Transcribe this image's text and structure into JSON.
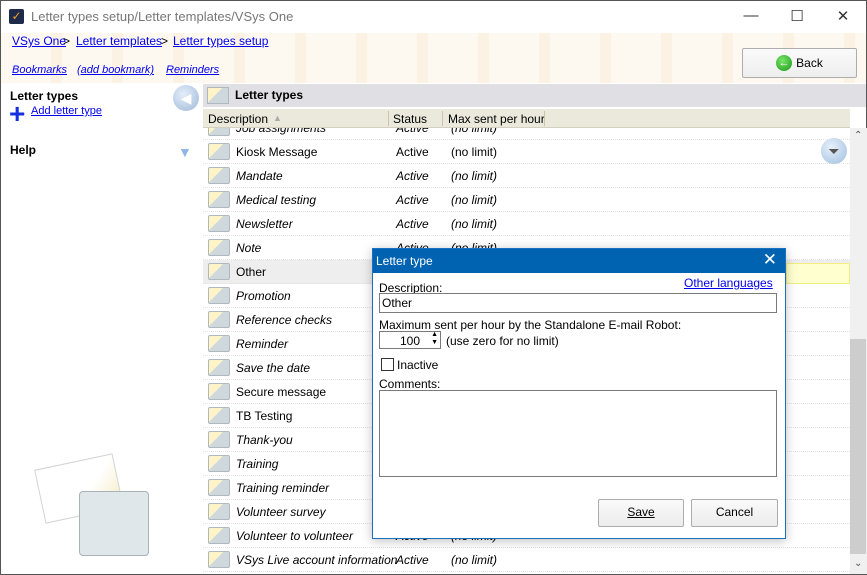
{
  "window": {
    "title": "Letter types setup/Letter templates/VSys One",
    "minimize": "—",
    "maximize": "☐",
    "close": "✕"
  },
  "breadcrumb": [
    {
      "label": "VSys One"
    },
    {
      "label": "Letter templates"
    },
    {
      "label": "Letter types setup"
    }
  ],
  "breadcrumb_sep": ">",
  "links": {
    "bookmarks": "Bookmarks",
    "add_bookmark": "(add bookmark)",
    "reminders": "Reminders"
  },
  "back_label": "Back",
  "sidebar": {
    "section1": "Letter types",
    "add_label": "Add letter type",
    "section2": "Help"
  },
  "grid": {
    "title": "Letter types",
    "columns": [
      "Description",
      "Status",
      "Max sent per hour"
    ],
    "sort_indicator": "▲",
    "rows": [
      {
        "d": "Job assignments",
        "s": "Active",
        "m": "(no limit)",
        "italic": true
      },
      {
        "d": "Kiosk Message",
        "s": "Active",
        "m": "(no limit)",
        "italic": false
      },
      {
        "d": "Mandate",
        "s": "Active",
        "m": "(no limit)",
        "italic": true
      },
      {
        "d": "Medical testing",
        "s": "Active",
        "m": "(no limit)",
        "italic": true
      },
      {
        "d": "Newsletter",
        "s": "Active",
        "m": "(no limit)",
        "italic": true
      },
      {
        "d": "Note",
        "s": "Active",
        "m": "(no limit)",
        "italic": true
      },
      {
        "d": "Other",
        "s": "",
        "m": "",
        "italic": false,
        "selected": true
      },
      {
        "d": "Promotion",
        "s": "",
        "m": "",
        "italic": true
      },
      {
        "d": "Reference checks",
        "s": "",
        "m": "",
        "italic": true
      },
      {
        "d": "Reminder",
        "s": "",
        "m": "",
        "italic": true
      },
      {
        "d": "Save the date",
        "s": "",
        "m": "",
        "italic": true
      },
      {
        "d": "Secure message",
        "s": "",
        "m": "",
        "italic": false
      },
      {
        "d": "TB Testing",
        "s": "",
        "m": "",
        "italic": false
      },
      {
        "d": "Thank-you",
        "s": "",
        "m": "",
        "italic": true
      },
      {
        "d": "Training",
        "s": "",
        "m": "",
        "italic": true
      },
      {
        "d": "Training reminder",
        "s": "",
        "m": "",
        "italic": true
      },
      {
        "d": "Volunteer survey",
        "s": "",
        "m": "",
        "italic": true
      },
      {
        "d": "Volunteer to volunteer",
        "s": "Active",
        "m": "(no limit)",
        "italic": true
      },
      {
        "d": "VSys Live account information",
        "s": "Active",
        "m": "(no limit)",
        "italic": true
      }
    ]
  },
  "dialog": {
    "title": "Letter type",
    "other_languages": "Other languages",
    "description_label": "Description:",
    "description_value": "Other",
    "max_label": "Maximum sent per hour by the Standalone E-mail Robot:",
    "max_value": "100",
    "max_hint": "(use zero for no limit)",
    "inactive_label": "Inactive",
    "inactive_checked": false,
    "comments_label": "Comments:",
    "comments_value": "",
    "save": "Save",
    "cancel": "Cancel"
  },
  "colors": {
    "dialog_title": "#0063b1",
    "link": "#0000ee",
    "grid_header": "#dfdfe4",
    "column_header": "#ebe9dc"
  }
}
